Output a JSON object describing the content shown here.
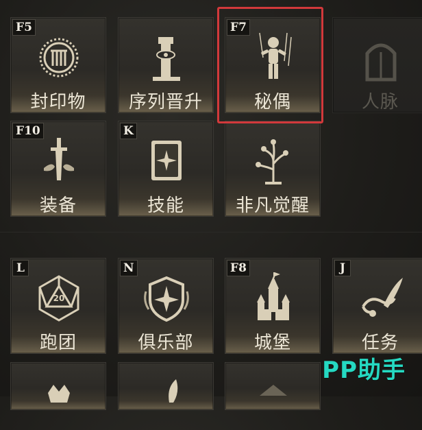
{
  "menu": {
    "row1": [
      {
        "hotkey": "F5",
        "label": "封印物",
        "icon": "seal-ring-icon"
      },
      {
        "hotkey": "",
        "label": "序列晋升",
        "icon": "pillar-eye-icon"
      },
      {
        "hotkey": "F7",
        "label": "秘偶",
        "icon": "puppet-icon"
      },
      {
        "hotkey": "",
        "label": "人脉",
        "icon": "door-arch-icon"
      }
    ],
    "row2": [
      {
        "hotkey": "F10",
        "label": "装备",
        "icon": "sword-icon"
      },
      {
        "hotkey": "K",
        "label": "技能",
        "icon": "book-icon"
      },
      {
        "hotkey": "",
        "label": "非凡觉醒",
        "icon": "tree-eyes-icon"
      }
    ],
    "row3": [
      {
        "hotkey": "L",
        "label": "跑团",
        "icon": "d20-dice-icon"
      },
      {
        "hotkey": "N",
        "label": "俱乐部",
        "icon": "shield-compass-icon"
      },
      {
        "hotkey": "F8",
        "label": "城堡",
        "icon": "castle-icon"
      },
      {
        "hotkey": "J",
        "label": "任务",
        "icon": "scroll-quill-icon"
      }
    ]
  },
  "watermark": "PP助手",
  "colors": {
    "highlight": "#d2393b",
    "watermark": "#25d9c2",
    "label": "#ece6d6"
  }
}
